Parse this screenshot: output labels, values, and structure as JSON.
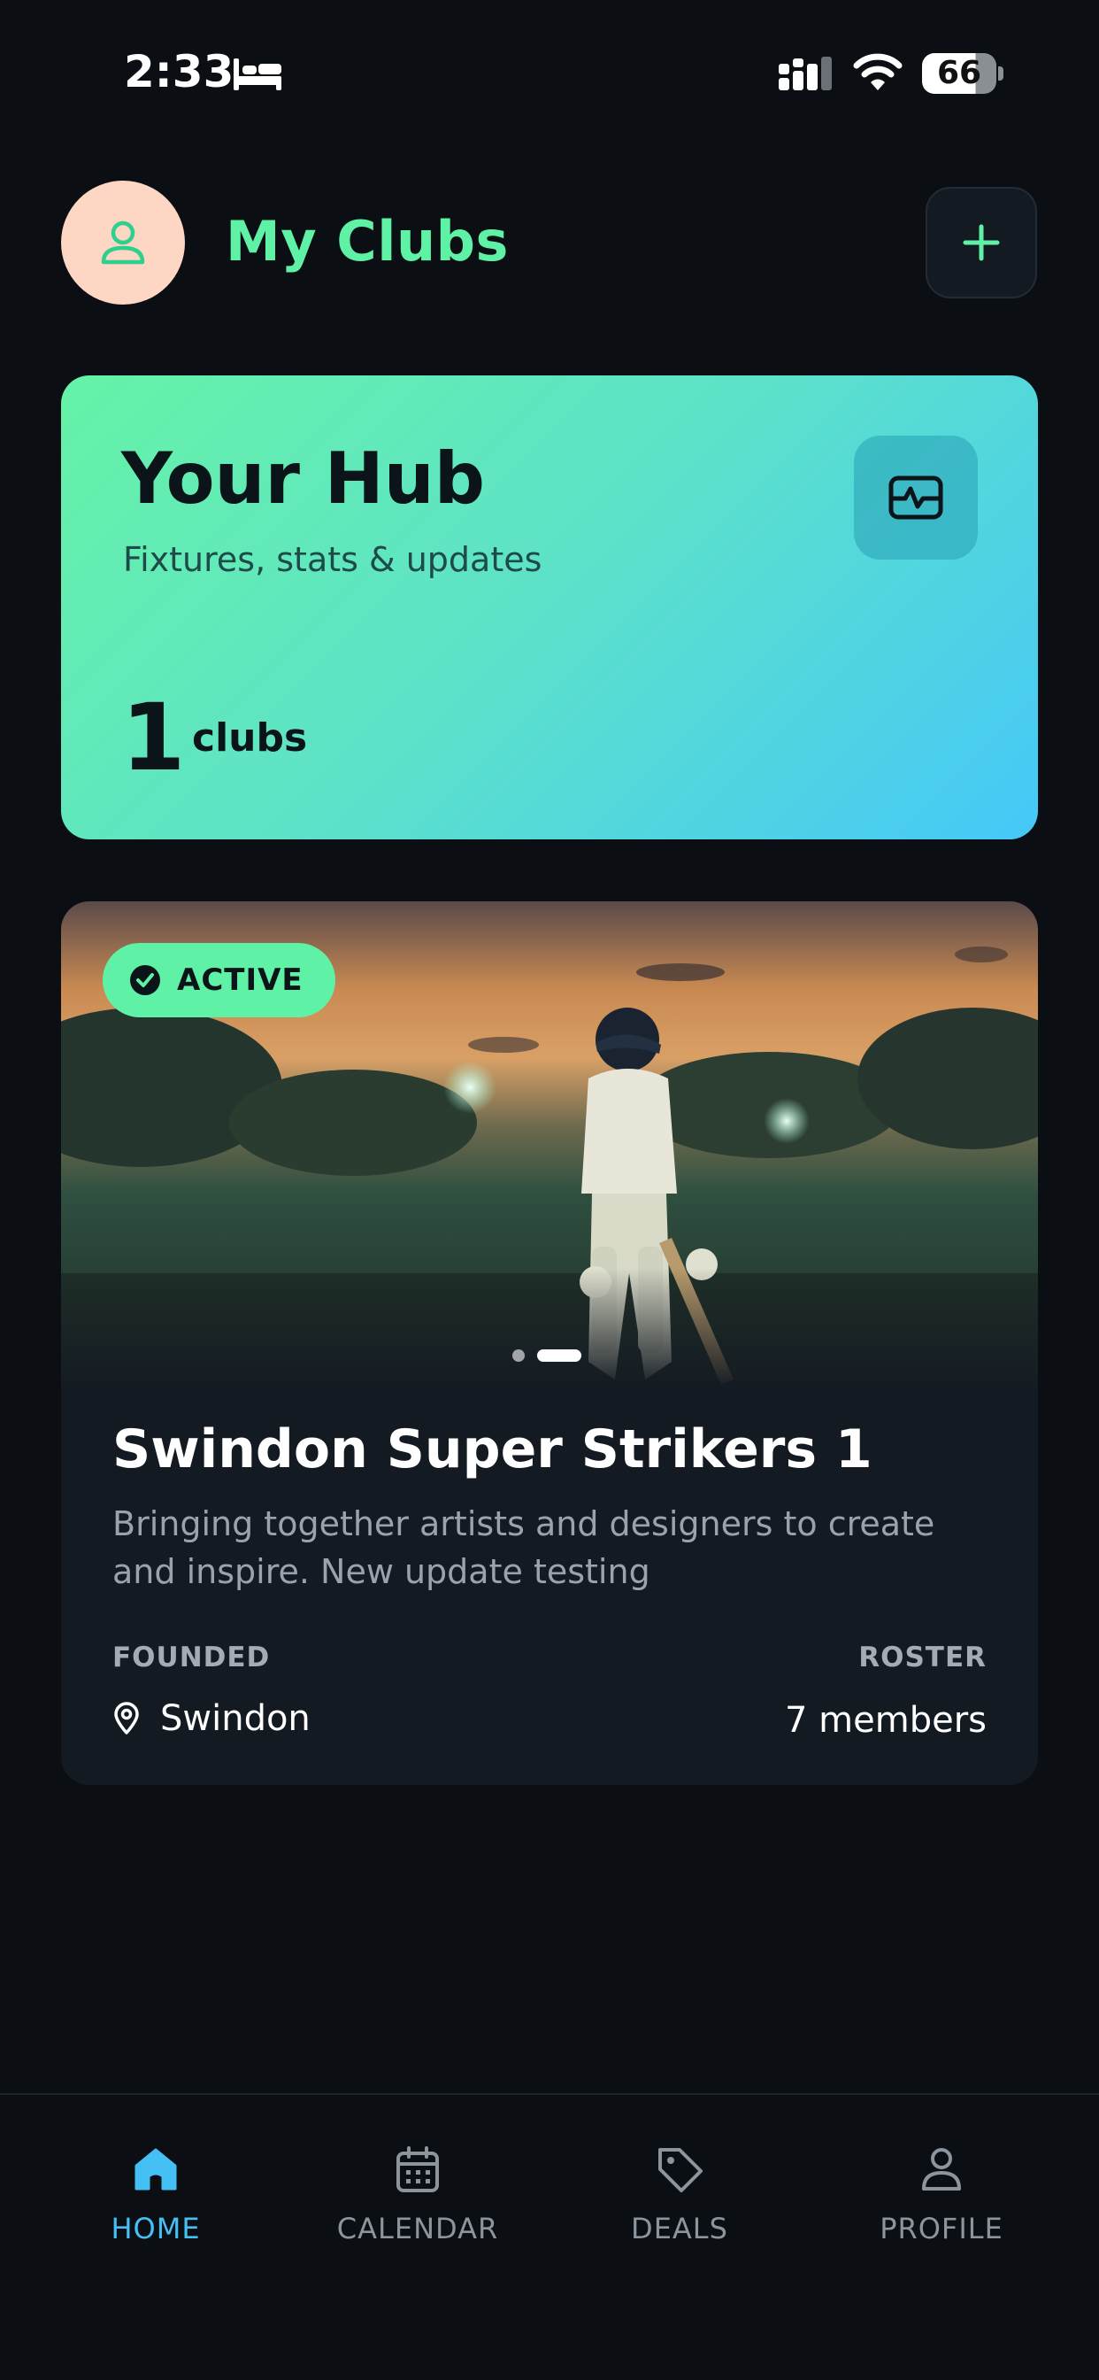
{
  "status_bar": {
    "time": "2:33",
    "battery": "66"
  },
  "header": {
    "title": "My Clubs",
    "avatar_icon": "user-icon",
    "add_icon": "plus-icon"
  },
  "hub": {
    "title": "Your Hub",
    "subtitle": "Fixtures, stats & updates",
    "count": "1",
    "count_label": "clubs",
    "icon": "activity-icon"
  },
  "club": {
    "status": "ACTIVE",
    "name": "Swindon Super Strikers 1",
    "description": "Bringing together artists and designers to create and inspire. New update testing",
    "founded_label": "FOUNDED",
    "roster_label": "ROSTER",
    "location": "Swindon",
    "members": "7 members",
    "carousel_pages": 2,
    "carousel_active": 2
  },
  "nav": {
    "items": [
      {
        "label": "HOME",
        "icon": "home-icon",
        "active": true
      },
      {
        "label": "CALENDAR",
        "icon": "calendar-icon",
        "active": false
      },
      {
        "label": "DEALS",
        "icon": "tag-icon",
        "active": false
      },
      {
        "label": "PROFILE",
        "icon": "user-icon",
        "active": false
      }
    ]
  },
  "colors": {
    "accent_green": "#5ff2a6",
    "accent_blue": "#45c0f5",
    "background": "#0b0f14",
    "card": "#141a22"
  }
}
